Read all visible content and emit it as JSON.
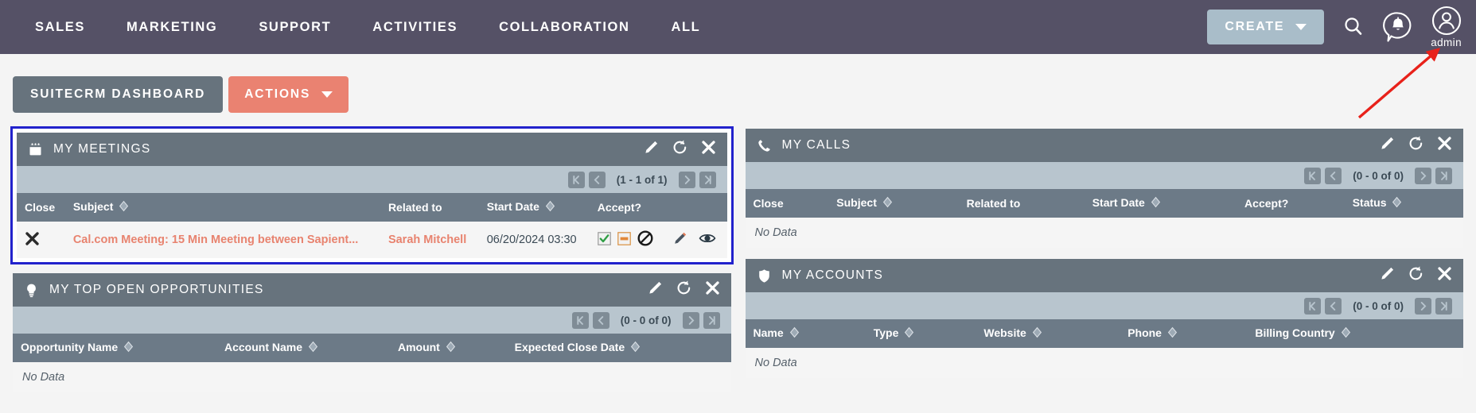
{
  "navbar": {
    "links": [
      {
        "label": "SALES",
        "name": "nav-sales"
      },
      {
        "label": "MARKETING",
        "name": "nav-marketing"
      },
      {
        "label": "SUPPORT",
        "name": "nav-support"
      },
      {
        "label": "ACTIVITIES",
        "name": "nav-activities"
      },
      {
        "label": "COLLABORATION",
        "name": "nav-collaboration"
      },
      {
        "label": "ALL",
        "name": "nav-all"
      }
    ],
    "create_label": "CREATE",
    "search_icon": "search-icon",
    "notifications_icon": "bell-notification-icon",
    "avatar_icon": "user-avatar-icon",
    "user_name": "admin"
  },
  "tabbar": {
    "dashboard_label": "SUITECRM DASHBOARD",
    "actions_label": "ACTIONS"
  },
  "colors": {
    "navbar_bg": "#555166",
    "create_btn": "#a9bdc9",
    "actions_btn": "#ea8271",
    "panel_header": "#67737d",
    "pager_bar": "#b8c5ce",
    "table_header": "#6c7a87",
    "link": "#e8836f",
    "focus_outline": "#2222cc",
    "annotation_arrow": "#e8211a"
  },
  "panels": {
    "meetings": {
      "title": "MY MEETINGS",
      "icon": "calendar-icon",
      "focused": true,
      "pagination": "(1 - 1 of 1)",
      "columns": [
        {
          "label": "Close",
          "sortable": false
        },
        {
          "label": "Subject",
          "sortable": true
        },
        {
          "label": "Related to",
          "sortable": false
        },
        {
          "label": "Start Date",
          "sortable": true
        },
        {
          "label": "Accept?",
          "sortable": false
        },
        {
          "label": "",
          "sortable": false
        }
      ],
      "rows": [
        {
          "close": "close-x-icon",
          "subject": "Cal.com Meeting: 15 Min Meeting between Sapient...",
          "related_to": "Sarah Mitchell",
          "start_date": "06/20/2024 03:30",
          "accept": [
            "accept-check-icon",
            "tentative-dash-icon",
            "decline-circle-slash-icon"
          ],
          "actions": [
            "edit-pencil-icon",
            "view-eye-icon"
          ]
        }
      ],
      "no_data": null
    },
    "calls": {
      "title": "MY CALLS",
      "icon": "phone-icon",
      "focused": false,
      "pagination": "(0 - 0 of 0)",
      "columns": [
        {
          "label": "Close",
          "sortable": false
        },
        {
          "label": "Subject",
          "sortable": true
        },
        {
          "label": "Related to",
          "sortable": false
        },
        {
          "label": "Start Date",
          "sortable": true
        },
        {
          "label": "Accept?",
          "sortable": false
        },
        {
          "label": "Status",
          "sortable": true
        }
      ],
      "rows": [],
      "no_data": "No Data"
    },
    "opportunities": {
      "title": "MY TOP OPEN OPPORTUNITIES",
      "icon": "lightbulb-icon",
      "focused": false,
      "pagination": "(0 - 0 of 0)",
      "columns": [
        {
          "label": "Opportunity Name",
          "sortable": true
        },
        {
          "label": "Account Name",
          "sortable": true
        },
        {
          "label": "Amount",
          "sortable": true
        },
        {
          "label": "Expected Close Date",
          "sortable": true
        }
      ],
      "rows": [],
      "no_data": "No Data"
    },
    "accounts": {
      "title": "MY ACCOUNTS",
      "icon": "shield-icon",
      "focused": false,
      "pagination": "(0 - 0 of 0)",
      "columns": [
        {
          "label": "Name",
          "sortable": true
        },
        {
          "label": "Type",
          "sortable": true
        },
        {
          "label": "Website",
          "sortable": true
        },
        {
          "label": "Phone",
          "sortable": true
        },
        {
          "label": "Billing Country",
          "sortable": true
        }
      ],
      "rows": [],
      "no_data": "No Data"
    }
  },
  "panel_header_icons": {
    "edit": "edit-pencil-icon",
    "refresh": "refresh-icon",
    "close": "close-x-icon"
  }
}
